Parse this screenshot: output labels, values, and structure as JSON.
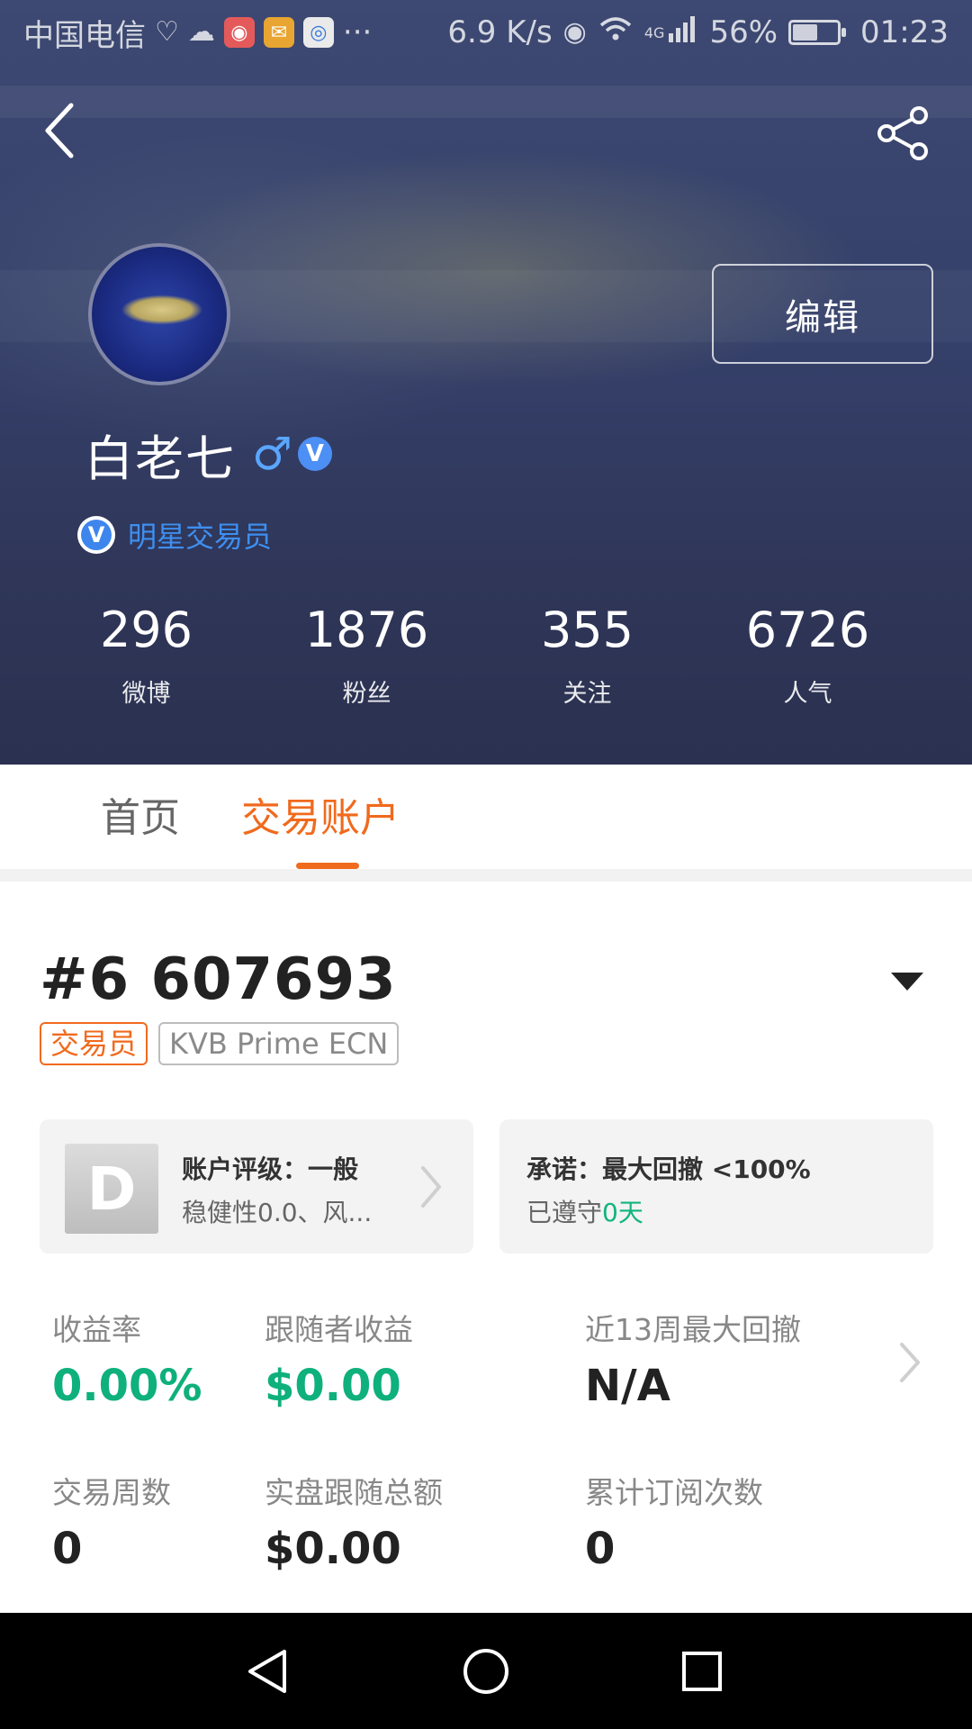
{
  "status_bar": {
    "carrier": "中国电信",
    "more": "···",
    "net_speed": "6.9 K/s",
    "network": "4G",
    "battery": "56%",
    "battery_level": 0.56,
    "time": "01:23"
  },
  "header": {
    "edit_label": "编辑",
    "name": "白老七",
    "gender_symbol": "♂",
    "verified_symbol": "V",
    "title": "明星交易员",
    "stats": [
      {
        "value": "296",
        "label": "微博"
      },
      {
        "value": "1876",
        "label": "粉丝"
      },
      {
        "value": "355",
        "label": "关注"
      },
      {
        "value": "6726",
        "label": "人气"
      }
    ]
  },
  "tabs": [
    {
      "label": "首页",
      "active": false
    },
    {
      "label": "交易账户",
      "active": true
    }
  ],
  "account": {
    "number": "#6 607693",
    "tags": [
      "交易员",
      "KVB Prime ECN"
    ],
    "rating_card": {
      "grade": "D",
      "title": "账户评级：一般",
      "subtitle": "稳健性0.0、风..."
    },
    "promise_card": {
      "title": "承诺：最大回撤 <100%",
      "subtitle_prefix": "已遵守",
      "days": "0天"
    },
    "metrics": [
      {
        "label": "收益率",
        "value": "0.00%"
      },
      {
        "label": "跟随者收益",
        "value": "$0.00"
      },
      {
        "label": "近13周最大回撤",
        "value": "N/A"
      },
      {
        "label": "交易周数",
        "value": "0"
      },
      {
        "label": "实盘跟随总额",
        "value": "$0.00"
      },
      {
        "label": "累计订阅次数",
        "value": "0"
      }
    ]
  },
  "colors": {
    "accent_orange": "#f06a1d",
    "positive_green": "#0eb07b",
    "verified_blue": "#3e8ff0",
    "header_bg": "#35406a"
  },
  "icons": {
    "back": "chevron-left-icon",
    "share": "share-icon",
    "dropdown": "caret-down-icon",
    "nav_back": "triangle-back-icon",
    "nav_home": "circle-home-icon",
    "nav_recent": "square-recent-icon"
  }
}
